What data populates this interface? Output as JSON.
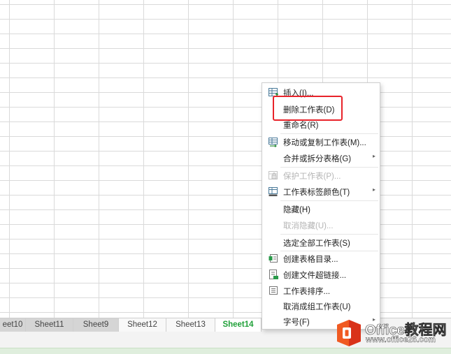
{
  "sheet_tabs": [
    {
      "label": "eet10",
      "style": "dark"
    },
    {
      "label": "Sheet11",
      "style": "dark"
    },
    {
      "label": "Sheet9",
      "style": "dark"
    },
    {
      "label": "Sheet12",
      "style": "light"
    },
    {
      "label": "Sheet13",
      "style": "light"
    },
    {
      "label": "Sheet14",
      "style": "active"
    }
  ],
  "context_menu": {
    "items": [
      {
        "label": "插入(I)...",
        "icon": "insert-sheet-icon",
        "enabled": true
      },
      {
        "label": "删除工作表(D)",
        "icon": "",
        "enabled": true,
        "highlighted": true
      },
      {
        "label": "重命名(R)",
        "icon": "",
        "enabled": true
      },
      {
        "label": "移动或复制工作表(M)...",
        "icon": "move-copy-icon",
        "enabled": true
      },
      {
        "label": "合并或拆分表格(G)",
        "icon": "",
        "enabled": true,
        "submenu": true
      },
      {
        "label": "保护工作表(P)...",
        "icon": "protect-sheet-icon",
        "enabled": false
      },
      {
        "label": "工作表标签颜色(T)",
        "icon": "tab-color-icon",
        "enabled": true,
        "submenu": true
      },
      {
        "label": "隐藏(H)",
        "icon": "",
        "enabled": true
      },
      {
        "label": "取消隐藏(U)...",
        "icon": "",
        "enabled": false
      },
      {
        "label": "选定全部工作表(S)",
        "icon": "",
        "enabled": true
      },
      {
        "label": "创建表格目录...",
        "icon": "table-directory-icon",
        "enabled": true
      },
      {
        "label": "创建文件超链接...",
        "icon": "file-hyperlink-icon",
        "enabled": true
      },
      {
        "label": "工作表排序...",
        "icon": "sort-sheets-icon",
        "enabled": true
      },
      {
        "label": "取消成组工作表(U)",
        "icon": "",
        "enabled": true
      },
      {
        "label": "字号(F)",
        "icon": "",
        "enabled": true,
        "submenu": true
      }
    ],
    "submenu_arrow": "▸"
  },
  "watermark": {
    "title": "Office教程网",
    "url": "www.office26.com",
    "colors": {
      "logo_orange": "#f05a22",
      "logo_red": "#d9331a"
    }
  },
  "colors": {
    "highlight_box": "#e8232a",
    "active_tab_text": "#21a13a",
    "status_bar": "#dfeedd"
  }
}
